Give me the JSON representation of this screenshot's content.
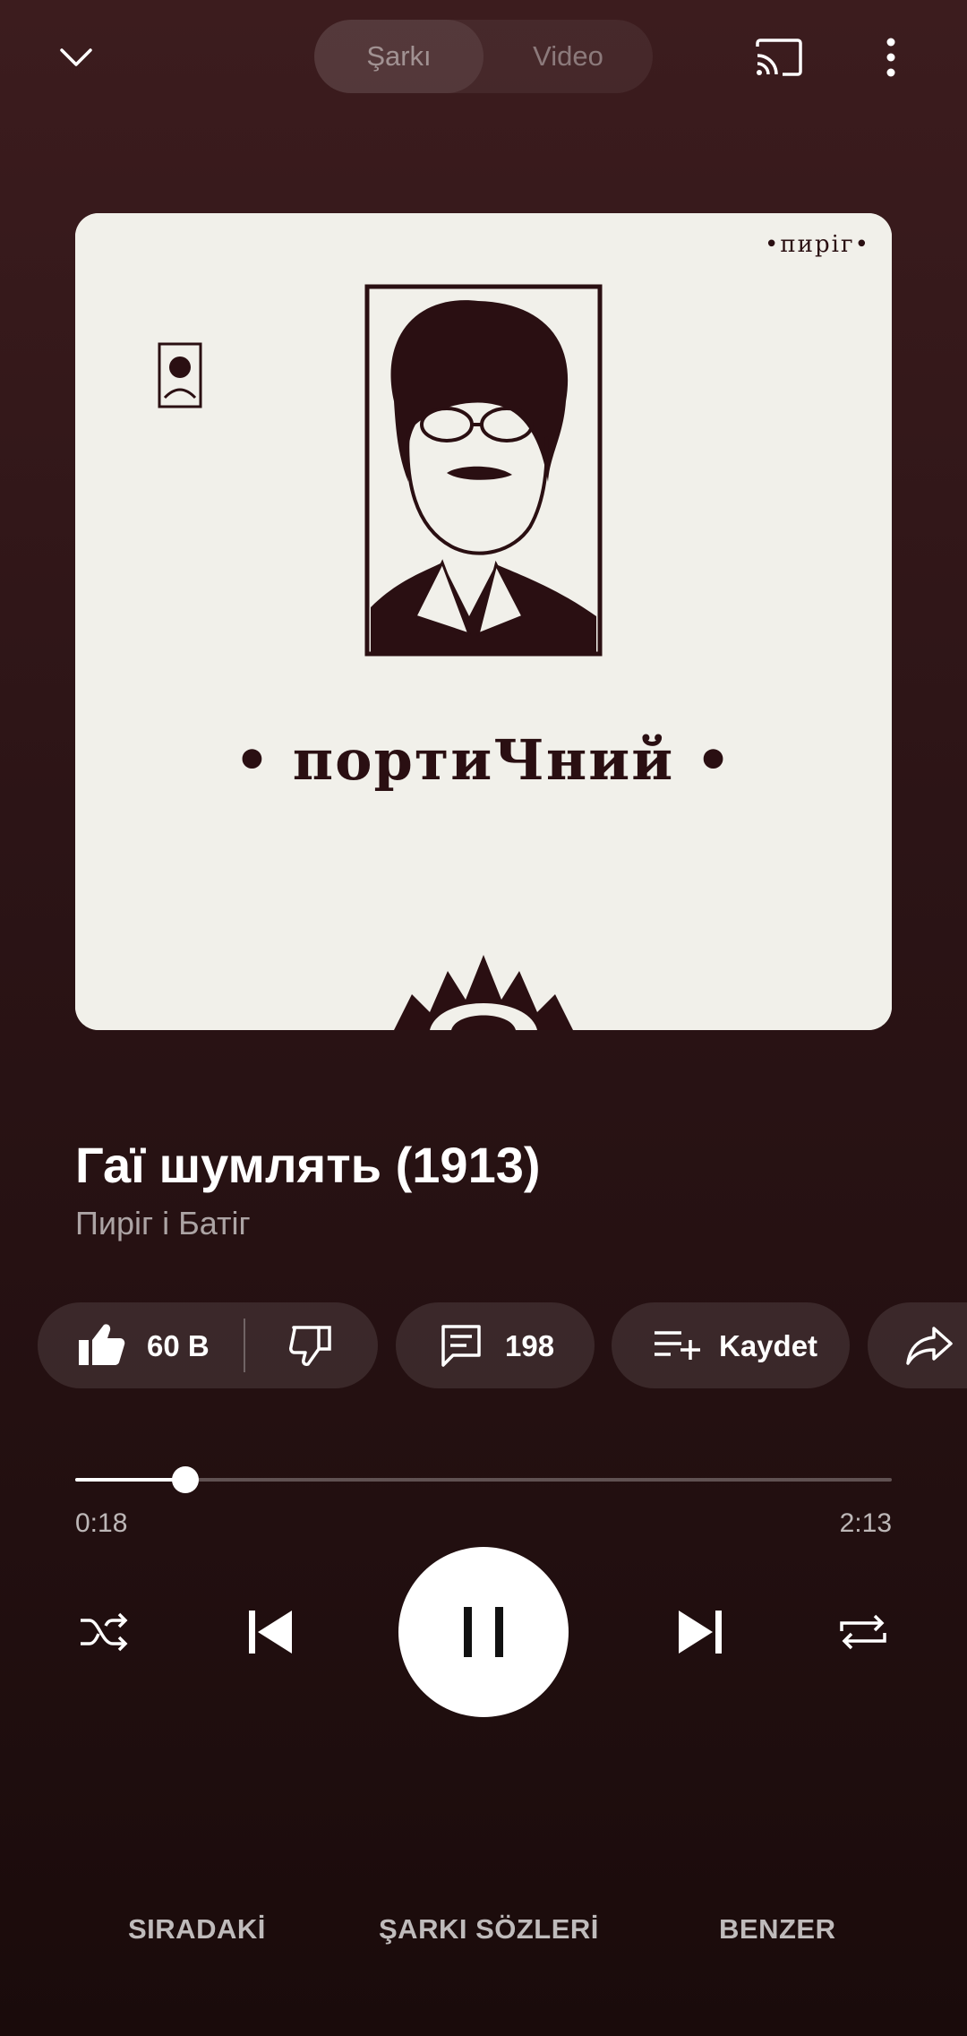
{
  "header": {
    "tabs": [
      {
        "label": "Şarkı",
        "active": true
      },
      {
        "label": "Video",
        "active": false
      }
    ]
  },
  "album_art": {
    "band_label": "•пиріг•",
    "album_title": "• портиЧний •"
  },
  "track": {
    "title": "Гаї шумлять (1913)",
    "artist": "Пиріг і Батіг"
  },
  "actions": {
    "like_count": "60 B",
    "comment_count": "198",
    "save_label": "Kaydet"
  },
  "player": {
    "current_time": "0:18",
    "duration": "2:13",
    "progress": 0.135
  },
  "bottom_tabs": [
    {
      "label": "SIRADAKİ"
    },
    {
      "label": "ŞARKI SÖZLERİ"
    },
    {
      "label": "BENZER"
    }
  ],
  "colors": {
    "background_top": "#3c1c1e",
    "background_bottom": "#1a0b0b",
    "art_paper": "#f1f0ea",
    "art_ink": "#2a0f12"
  }
}
